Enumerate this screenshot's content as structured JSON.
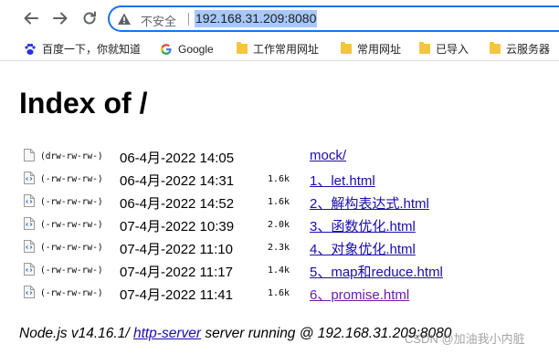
{
  "browser": {
    "security_label": "不安全",
    "url": "192.168.31.209:8080"
  },
  "bookmarks": [
    {
      "label": "百度一下，你就知道",
      "icon": "baidu-paw-icon"
    },
    {
      "label": "Google",
      "icon": "google-g-icon"
    },
    {
      "label": "工作常用网址",
      "icon": "folder-icon"
    },
    {
      "label": "常用网址",
      "icon": "folder-icon"
    },
    {
      "label": "已导入",
      "icon": "folder-icon"
    },
    {
      "label": "云服务器",
      "icon": "folder-icon"
    }
  ],
  "page": {
    "title": "Index of /",
    "entries": [
      {
        "perm": "(drw-rw-rw-)",
        "date": "06-4月-2022 14:05",
        "size": "",
        "name": "mock/",
        "type": "folder"
      },
      {
        "perm": "(-rw-rw-rw-)",
        "date": "06-4月-2022 14:31",
        "size": "1.6k",
        "name": "1、let.html",
        "type": "file"
      },
      {
        "perm": "(-rw-rw-rw-)",
        "date": "06-4月-2022 14:52",
        "size": "1.6k",
        "name": "2、解构表达式.html",
        "type": "file"
      },
      {
        "perm": "(-rw-rw-rw-)",
        "date": "07-4月-2022 10:39",
        "size": "2.0k",
        "name": "3、函数优化.html",
        "type": "file"
      },
      {
        "perm": "(-rw-rw-rw-)",
        "date": "07-4月-2022 11:10",
        "size": "2.3k",
        "name": "4、对象优化.html",
        "type": "file"
      },
      {
        "perm": "(-rw-rw-rw-)",
        "date": "07-4月-2022 11:17",
        "size": "1.4k",
        "name": "5、map和reduce.html",
        "type": "file"
      },
      {
        "perm": "(-rw-rw-rw-)",
        "date": "07-4月-2022 11:41",
        "size": "1.6k",
        "name": "6、promise.html",
        "type": "file",
        "visited": true
      }
    ],
    "footer": {
      "prefix": "Node.js v14.16.1/ ",
      "link": "http-server",
      "suffix": " server running @ 192.168.31.209:8080"
    }
  },
  "watermark": "CSDN @加油我小内脏",
  "colors": {
    "link": "#1a0dab",
    "visited": "#681da8",
    "accent": "#1a73e8"
  }
}
